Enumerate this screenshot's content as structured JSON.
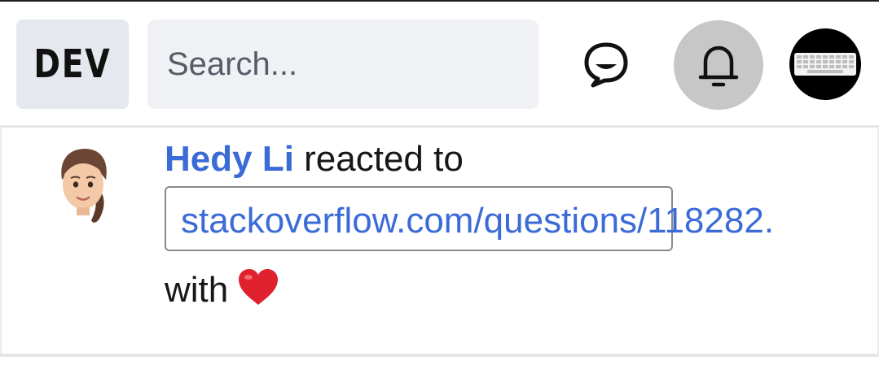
{
  "header": {
    "logo_text": "DEV",
    "search_placeholder": "Search..."
  },
  "notification": {
    "username": "Hedy Li",
    "action_text": " reacted to",
    "link_text": "stackoverflow.com/questions/118282.",
    "suffix_text": "with",
    "reaction_icon": "heart-icon"
  },
  "colors": {
    "link": "#3b6bd6",
    "logo_bg": "#e5e8ee",
    "search_bg": "#f0f1f4",
    "bell_bg": "#c7c7c7",
    "heart": "#e0212e"
  }
}
